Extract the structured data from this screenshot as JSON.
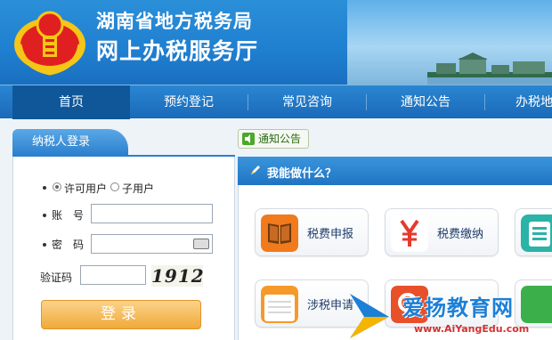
{
  "header": {
    "title_line1": "湖南省地方税务局",
    "title_line2": "网上办税服务厅"
  },
  "nav": {
    "items": [
      {
        "label": "首页",
        "active": true
      },
      {
        "label": "预约登记",
        "active": false
      },
      {
        "label": "常见咨询",
        "active": false
      },
      {
        "label": "通知公告",
        "active": false
      },
      {
        "label": "办税地",
        "active": false
      }
    ]
  },
  "login": {
    "tab_label": "纳税人登录",
    "user_types": [
      {
        "label": "许可用户",
        "selected": true
      },
      {
        "label": "子用户",
        "selected": false
      }
    ],
    "account_label": "账　号",
    "account_value": "",
    "password_label": "密　码",
    "password_value": "",
    "captcha_label": "验证码",
    "captcha_value": "",
    "captcha_image_text": "1912",
    "submit_label": "登录"
  },
  "notice": {
    "button_label": "通知公告"
  },
  "services": {
    "title": "我能做什么？",
    "cards": [
      {
        "label": "税费申报",
        "icon": "book-icon",
        "color": "#f07a1c"
      },
      {
        "label": "税费缴纳",
        "icon": "yen-icon",
        "color": "#e53a2c"
      },
      {
        "label": "",
        "icon": "list-icon",
        "color": "#27a8a0"
      },
      {
        "label": "涉税申请",
        "icon": "notepad-icon",
        "color": "#f59a2a"
      },
      {
        "label": "",
        "icon": "search-icon",
        "color": "#e8502a"
      },
      {
        "label": "",
        "icon": "app-icon",
        "color": "#3bb04a"
      }
    ]
  },
  "watermark": {
    "text": "爱扬教育网",
    "url": "www.AiYangEdu.com"
  }
}
